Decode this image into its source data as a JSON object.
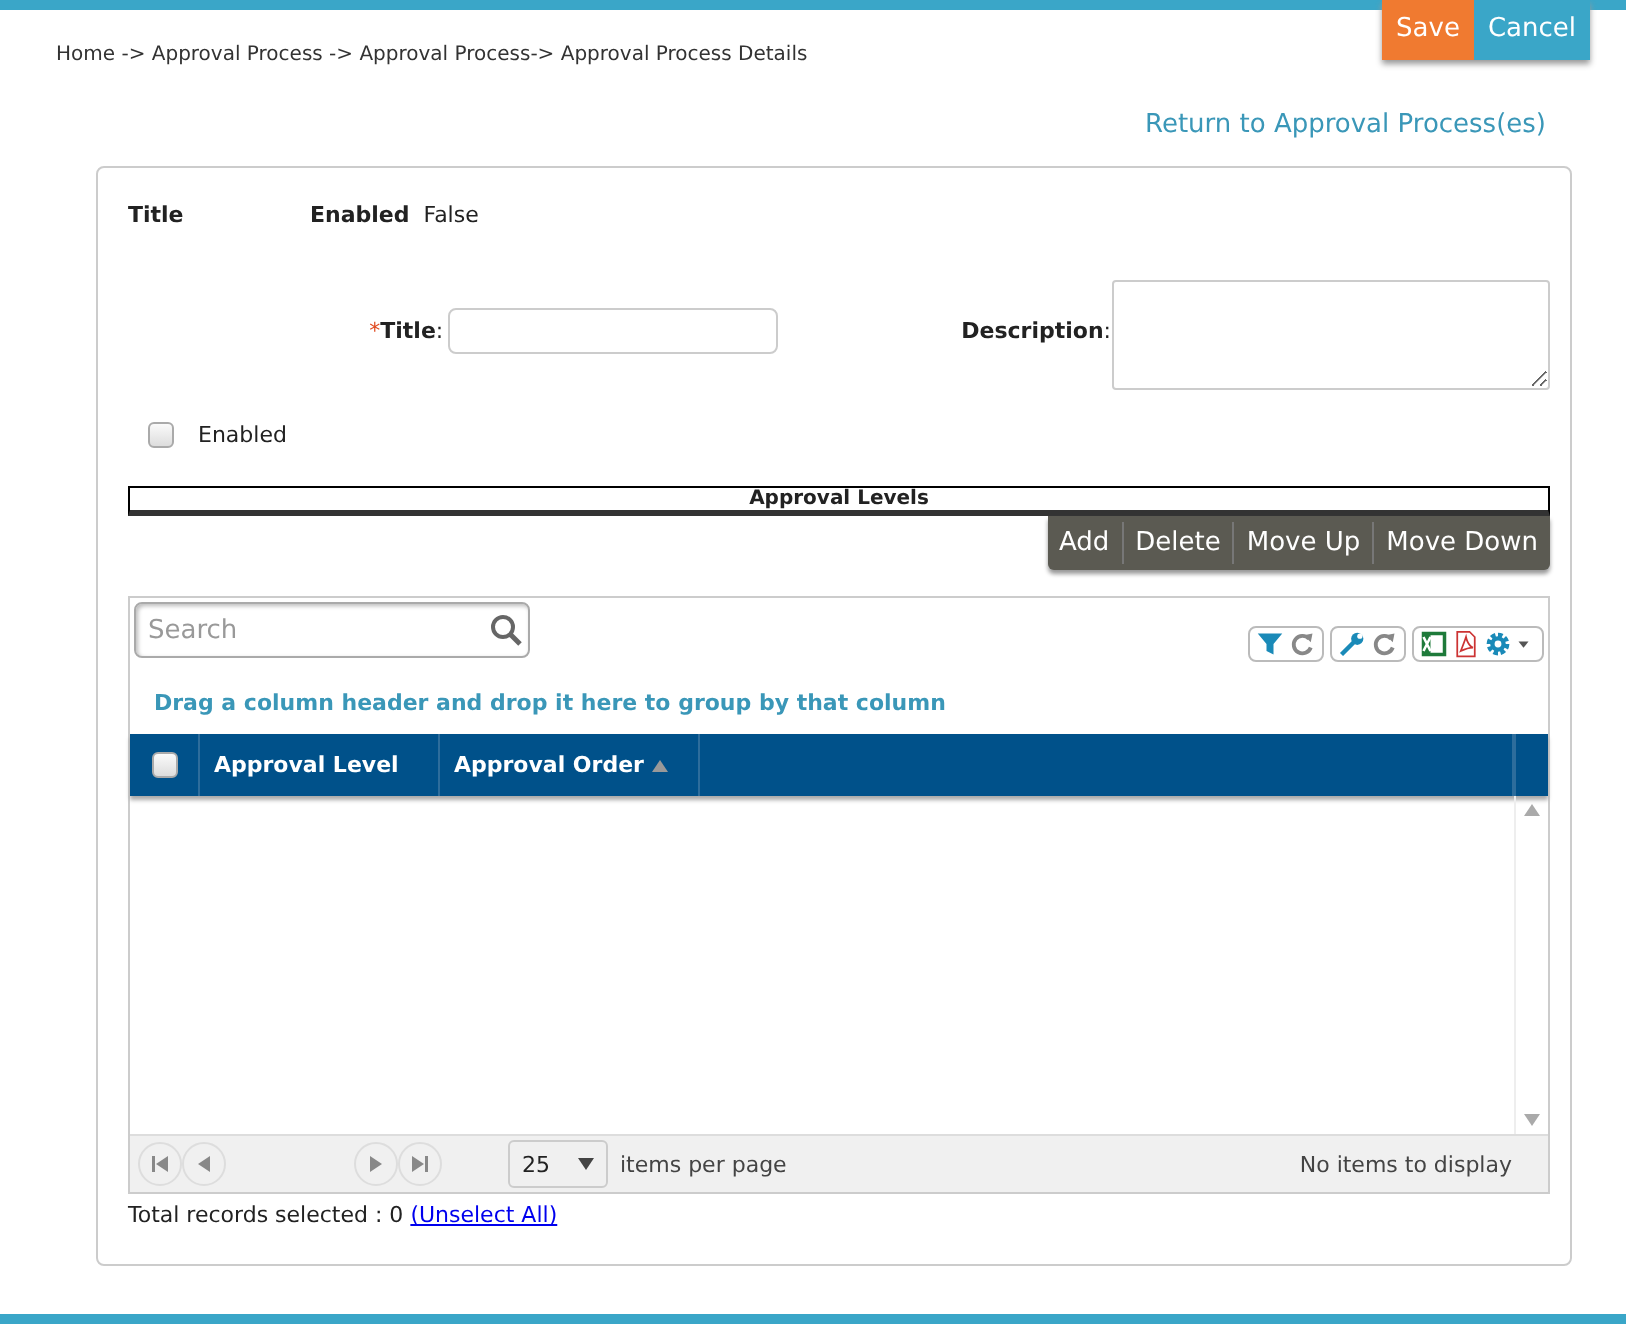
{
  "header": {
    "buttons": [
      {
        "label": "Save",
        "kind": "primary"
      },
      {
        "label": "Cancel",
        "kind": "secondary"
      }
    ],
    "breadcrumb": "Home -> Approval Process -> Approval Process-> Approval Process Details",
    "return_link": "Return to Approval Process(es)"
  },
  "summary": {
    "title_label": "Title",
    "enabled_label": "Enabled",
    "enabled_value": "False"
  },
  "form": {
    "required_mark": "*",
    "title_label": "**Title**:",
    "description_label": "**Description**:",
    "enabled": {
      "label": "Enabled",
      "checked": false
    }
  },
  "section_title": "Approval Levels",
  "toolbar": [
    "Add",
    "Delete",
    "Move Up",
    "Move Down"
  ],
  "grid": {
    "search": {
      "placeholder": "Search"
    },
    "group_hint": "Drag a column header and drop it here to group by that column",
    "header_checkbox": {
      "checked": false
    },
    "columns": [
      {
        "label": "Approval Level",
        "sorted": false
      },
      {
        "label": "Approval Order",
        "sorted": true
      }
    ],
    "pager": {
      "page_size": "25",
      "items_per_page": "items per page",
      "status": "No items to display"
    }
  },
  "footer": {
    "text": "Total records selected : 0",
    "link": "(Unselect All)"
  }
}
